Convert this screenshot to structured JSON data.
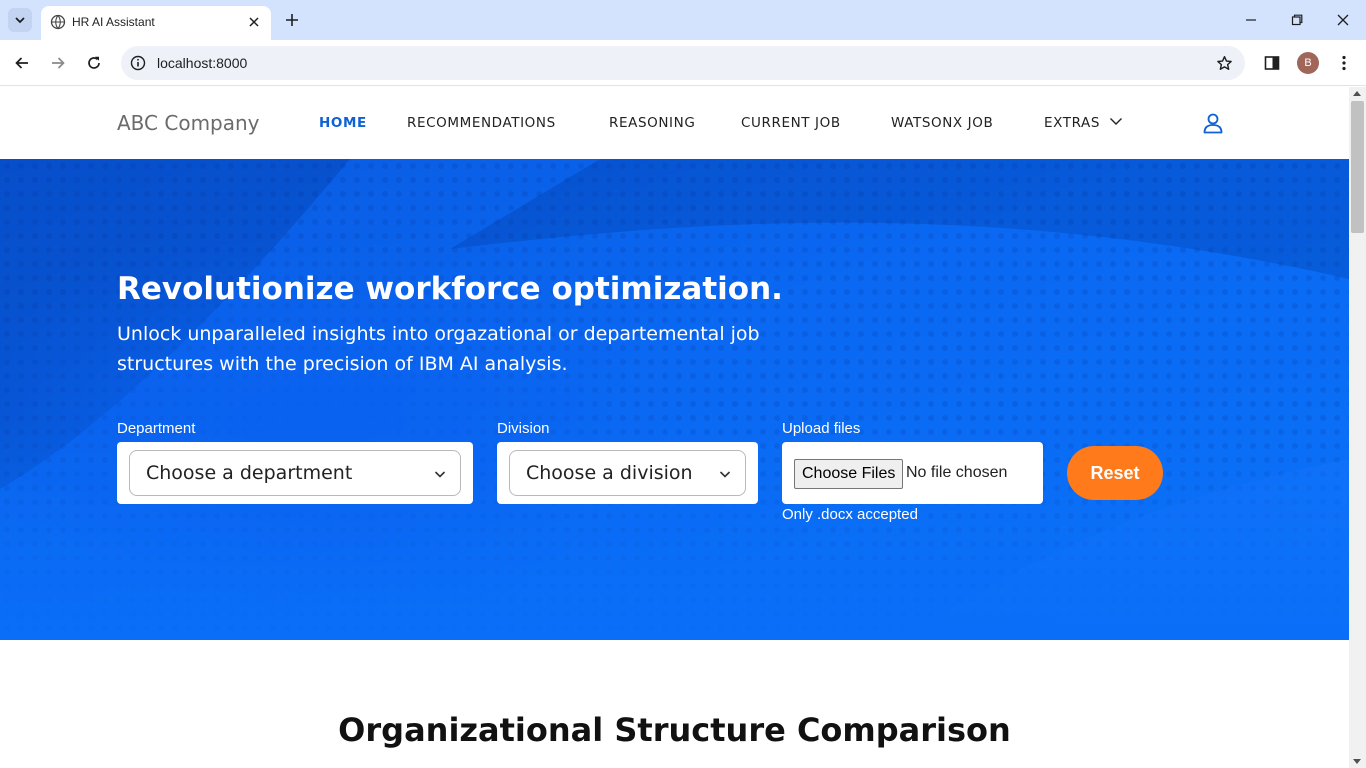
{
  "browser": {
    "tab_title": "HR AI Assistant",
    "url": "localhost:8000",
    "profile_initial": "B"
  },
  "header": {
    "brand": "ABC Company",
    "nav": [
      {
        "label": "HOME",
        "active": true
      },
      {
        "label": "RECOMMENDATIONS",
        "active": false
      },
      {
        "label": "REASONING",
        "active": false
      },
      {
        "label": "CURRENT JOB",
        "active": false
      },
      {
        "label": "WATSONX JOB",
        "active": false
      },
      {
        "label": "EXTRAS",
        "active": false
      }
    ]
  },
  "hero": {
    "title": "Revolutionize workforce optimization.",
    "subtitle": "Unlock unparalleled insights into orgazational or departemental job structures with the precision of IBM AI analysis.",
    "department": {
      "label": "Department",
      "value": "Choose a department"
    },
    "division": {
      "label": "Division",
      "value": "Choose a division"
    },
    "upload": {
      "label": "Upload files",
      "button_label": "Choose Files",
      "status": "No file chosen",
      "hint": "Only .docx accepted"
    },
    "reset_label": "Reset"
  },
  "section": {
    "title": "Organizational Structure Comparison"
  },
  "colors": {
    "brand_blue": "#0f62d6",
    "hero_blue": "#0a68f2",
    "reset_orange": "#ff7a1a"
  }
}
